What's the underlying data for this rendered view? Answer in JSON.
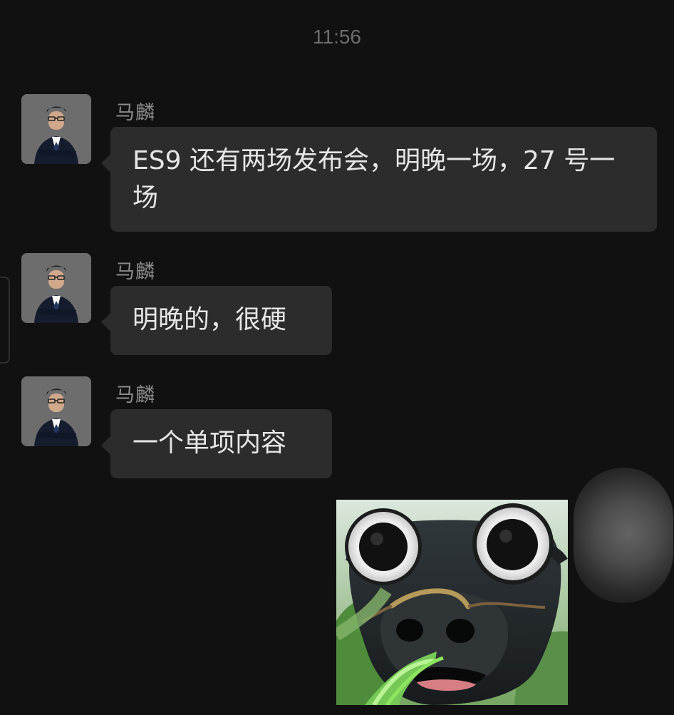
{
  "timestamp": "11:56",
  "messages": [
    {
      "sender": "马麟",
      "text": "ES9 还有两场发布会，明晚一场，27 号一场"
    },
    {
      "sender": "马麟",
      "text": "明晚的，很硬"
    },
    {
      "sender": "马麟",
      "text": "一个单项内容"
    }
  ],
  "image_message": {
    "icon": "photo-icon"
  },
  "icons": {
    "avatar": "user-avatar-icon",
    "self_avatar": "blurred-avatar-icon"
  },
  "colors": {
    "background": "#111111",
    "bubble": "#2c2c2c",
    "sender": "#8c8c8c",
    "timestamp": "#6d6d6d",
    "text": "#e6e6e6"
  }
}
